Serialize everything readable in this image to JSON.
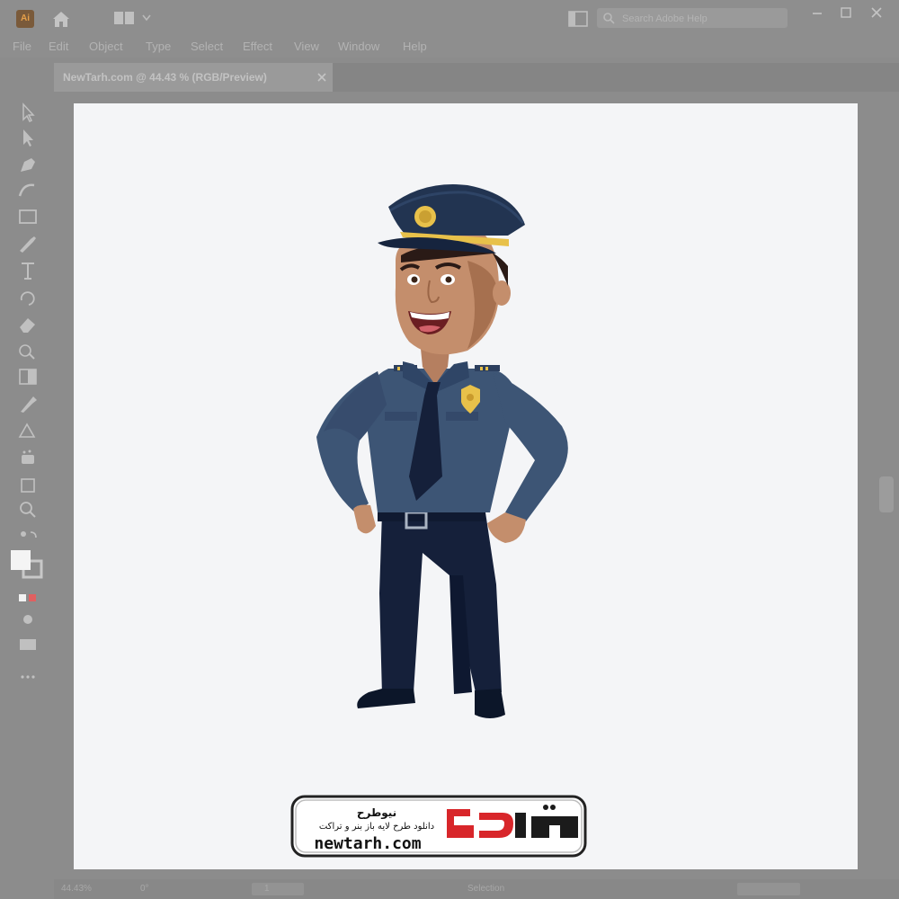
{
  "app": {
    "logo_text": "Ai",
    "search_placeholder": "Search Adobe Help",
    "menu": [
      "File",
      "Edit",
      "Object",
      "Type",
      "Select",
      "Effect",
      "View",
      "Window",
      "Help"
    ]
  },
  "document": {
    "tab_label": "NewTarh.com @ 44.43 % (RGB/Preview)"
  },
  "status": {
    "zoom": "44.43%",
    "angle": "0°",
    "artboard_number": "1",
    "mode": "Selection"
  },
  "watermark": {
    "brand_fa": "نیوطرح",
    "tagline_fa": "دانلود طرح لایه باز بنر و تراکت",
    "url": "newtarh.com"
  },
  "colors": {
    "uniform": "#3d5575",
    "cap": "#223451",
    "pants": "#15203a",
    "skin": "#c48e6c",
    "badge": "#e8c14a",
    "logo_red": "#d8262a"
  },
  "icons": {
    "toolbar": [
      "selection-tool-icon",
      "direct-selection-tool-icon",
      "pen-tool-icon",
      "curvature-tool-icon",
      "rectangle-tool-icon",
      "paintbrush-tool-icon",
      "type-tool-icon",
      "rotate-tool-icon",
      "eraser-tool-icon",
      "shape-builder-icon",
      "gradient-tool-icon",
      "eyedropper-tool-icon",
      "blend-tool-icon",
      "symbol-sprayer-icon",
      "artboard-tool-icon",
      "zoom-tool-icon"
    ]
  }
}
